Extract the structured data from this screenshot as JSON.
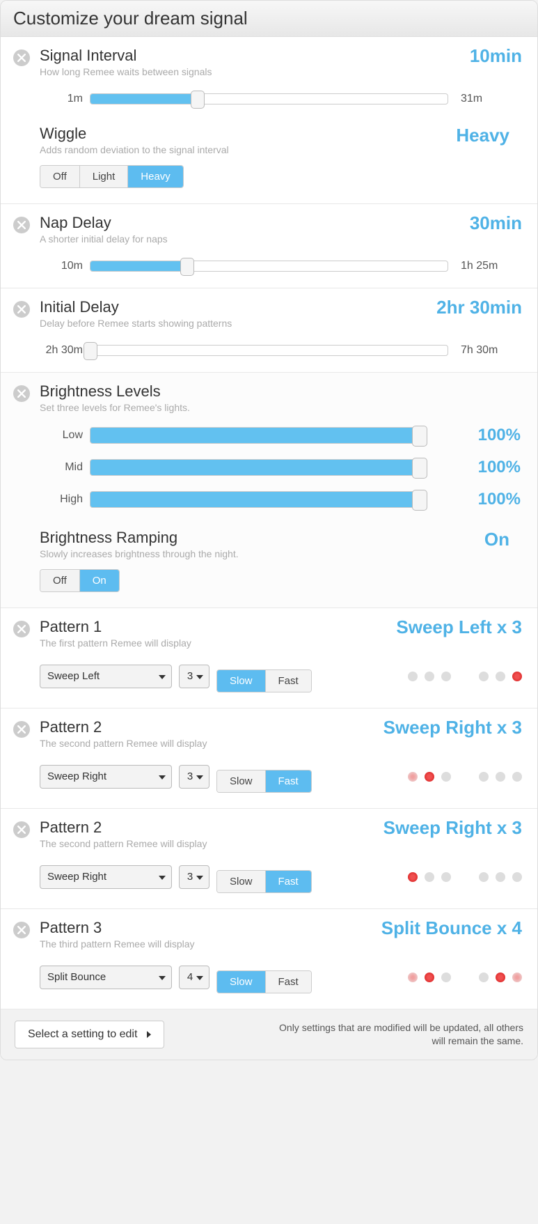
{
  "header": {
    "title": "Customize your dream signal"
  },
  "signal_interval": {
    "title": "Signal Interval",
    "desc": "How long Remee waits between signals",
    "value": "10min",
    "left": "1m",
    "right": "31m",
    "fill_pct": 30
  },
  "wiggle": {
    "title": "Wiggle",
    "desc": "Adds random deviation to the signal interval",
    "value": "Heavy",
    "options": [
      "Off",
      "Light",
      "Heavy"
    ],
    "active": "Heavy"
  },
  "nap_delay": {
    "title": "Nap Delay",
    "desc": "A shorter initial delay for naps",
    "value": "30min",
    "left": "10m",
    "right": "1h 25m",
    "fill_pct": 27
  },
  "initial_delay": {
    "title": "Initial Delay",
    "desc": "Delay before Remee starts showing patterns",
    "value": "2hr 30min",
    "left": "2h 30m",
    "right": "7h 30m",
    "fill_pct": 0
  },
  "brightness": {
    "title": "Brightness Levels",
    "desc": "Set three levels for Remee's lights.",
    "rows": [
      {
        "label": "Low",
        "value": "100%"
      },
      {
        "label": "Mid",
        "value": "100%"
      },
      {
        "label": "High",
        "value": "100%"
      }
    ]
  },
  "ramping": {
    "title": "Brightness Ramping",
    "desc": "Slowly increases brightness through the night.",
    "value": "On",
    "options": [
      "Off",
      "On"
    ],
    "active": "On"
  },
  "patterns": [
    {
      "title": "Pattern 1",
      "desc": "The first pattern Remee will display",
      "value": "Sweep Left x 3",
      "select": "Sweep Left",
      "count": "3",
      "speed_active": "Slow",
      "dots": [
        "off",
        "off",
        "off",
        "gap",
        "off",
        "off",
        "red"
      ]
    },
    {
      "title": "Pattern 2",
      "desc": "The second pattern Remee will display",
      "value": "Sweep Right x 3",
      "select": "Sweep Right",
      "count": "3",
      "speed_active": "Fast",
      "dots": [
        "fade",
        "red",
        "off",
        "gap",
        "off",
        "off",
        "off"
      ]
    },
    {
      "title": "Pattern 2",
      "desc": "The second pattern Remee will display",
      "value": "Sweep Right x 3",
      "select": "Sweep Right",
      "count": "3",
      "speed_active": "Fast",
      "dots": [
        "red",
        "off",
        "off",
        "gap",
        "off",
        "off",
        "off"
      ]
    },
    {
      "title": "Pattern 3",
      "desc": "The third pattern Remee will display",
      "value": "Split Bounce x 4",
      "select": "Split Bounce",
      "count": "4",
      "speed_active": "Slow",
      "dots": [
        "fade",
        "red",
        "off",
        "gap",
        "off",
        "red",
        "fade"
      ]
    }
  ],
  "speed_options": [
    "Slow",
    "Fast"
  ],
  "footer": {
    "select_label": "Select a setting to edit",
    "note": "Only settings that are modified will be updated, all others will remain the same."
  }
}
